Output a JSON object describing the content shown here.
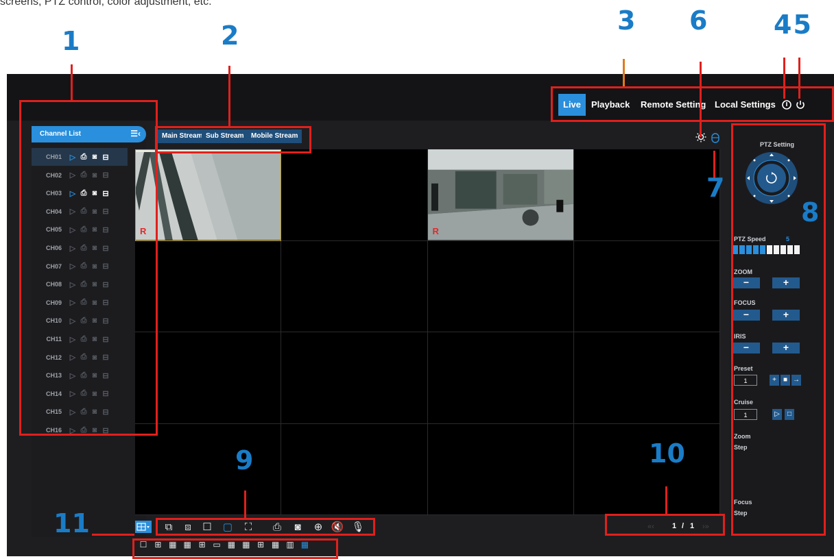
{
  "top_caption": "screens, PTZ control, color adjustment, etc.",
  "callouts": {
    "c1": "1",
    "c2": "2",
    "c3": "3",
    "c6": "6",
    "c45": "45",
    "c7": "7",
    "c8": "8",
    "c9": "9",
    "c10": "10",
    "c11": "11"
  },
  "nav": {
    "live": "Live",
    "playback": "Playback",
    "remote": "Remote Setting",
    "local": "Local Settings"
  },
  "channel_list": {
    "title": "Channel List",
    "channels": [
      "CH01",
      "CH02",
      "CH03",
      "CH04",
      "CH05",
      "CH06",
      "CH07",
      "CH08",
      "CH09",
      "CH10",
      "CH11",
      "CH12",
      "CH13",
      "CH14",
      "CH15",
      "CH16"
    ]
  },
  "streams": {
    "main": "Main Stream",
    "sub": "Sub Stream",
    "mobile": "Mobile Stream"
  },
  "video": {
    "rec_mark": "R"
  },
  "ptz": {
    "title": "PTZ Setting",
    "speed_label": "PTZ Speed",
    "speed_value": "5",
    "speed_level": 5,
    "speed_max": 10,
    "zoom_label": "ZOOM",
    "focus_label": "FOCUS",
    "iris_label": "IRIS",
    "minus": "−",
    "plus": "+",
    "preset_label": "Preset",
    "preset_value": "1",
    "cruise_label": "Cruise",
    "cruise_value": "1",
    "zoom_step_label": "Zoom",
    "zoom_step_sub": "Step",
    "focus_step_label": "Focus",
    "focus_step_sub": "Step"
  },
  "pagination": {
    "current": "1",
    "separator": "/",
    "total": "1"
  },
  "colors": {
    "accent": "#2a8fdc",
    "callout": "#1a7cc7",
    "highlight": "#e0201c",
    "background": "#1e1e21"
  }
}
